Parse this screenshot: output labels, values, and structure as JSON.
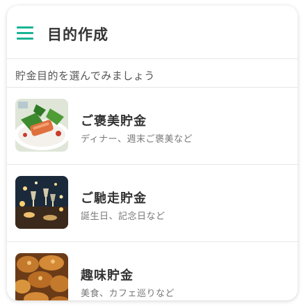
{
  "header": {
    "title": "目的作成",
    "menu_icon": "hamburger-menu-icon",
    "accent_color": "#19b394"
  },
  "subtitle": "貯金目的を選んでみましょう",
  "items": [
    {
      "title": "ご褒美貯金",
      "description": "ディナー、週末ご褒美など",
      "image": "salmon-dinner-photo"
    },
    {
      "title": "ご馳走貯金",
      "description": "誕生日、記念日など",
      "image": "celebration-toast-photo"
    },
    {
      "title": "趣味貯金",
      "description": "美食、カフェ巡りなど",
      "image": "pastries-photo"
    }
  ]
}
